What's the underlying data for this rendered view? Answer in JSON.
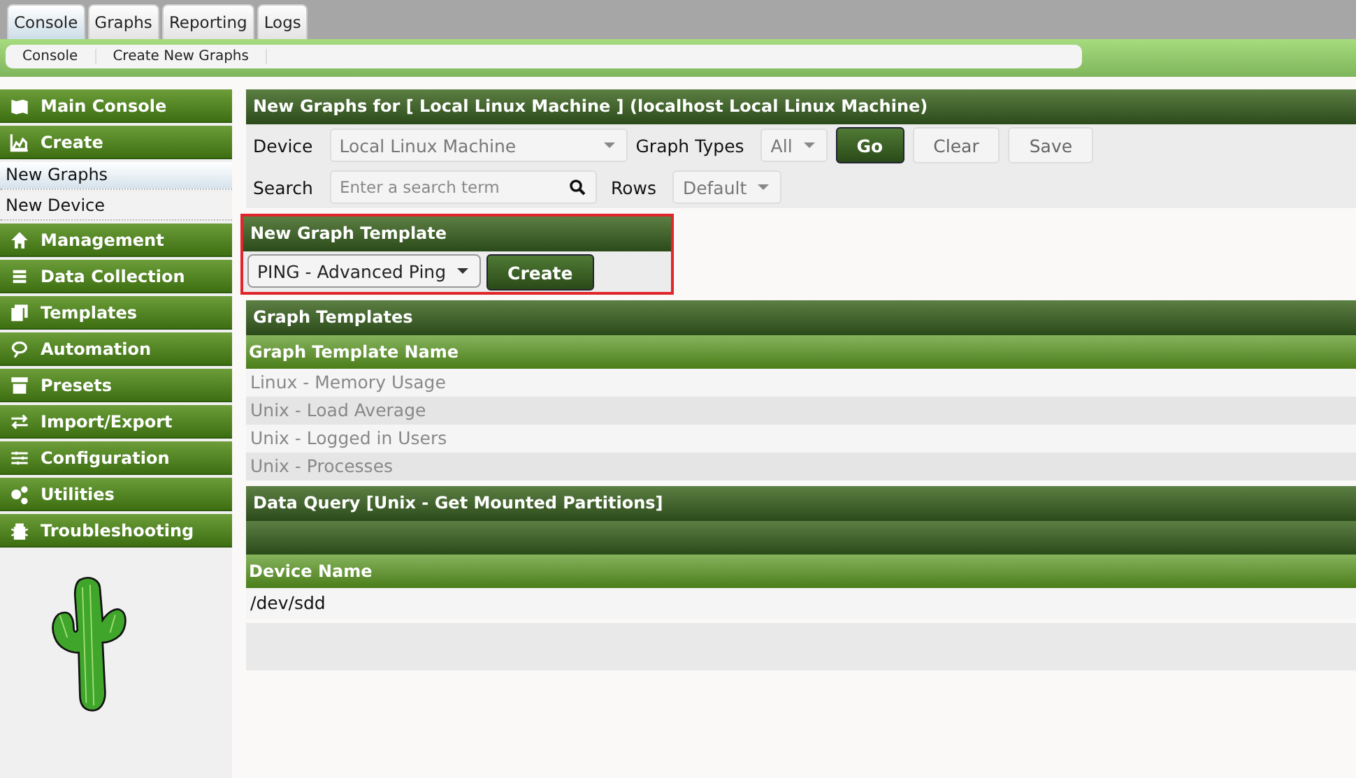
{
  "tabs": [
    {
      "label": "Console",
      "selected": true
    },
    {
      "label": "Graphs",
      "selected": false
    },
    {
      "label": "Reporting",
      "selected": false
    },
    {
      "label": "Logs",
      "selected": false
    }
  ],
  "breadcrumb": [
    "Console",
    "Create New Graphs"
  ],
  "sidebar": {
    "items": [
      {
        "kind": "header",
        "label": "Main Console",
        "selected": false
      },
      {
        "kind": "header",
        "label": "Create",
        "selected": false
      },
      {
        "kind": "sub",
        "label": "New Graphs",
        "selected": true
      },
      {
        "kind": "sub",
        "label": "New Device",
        "selected": false
      },
      {
        "kind": "header",
        "label": "Management",
        "selected": false
      },
      {
        "kind": "header",
        "label": "Data Collection",
        "selected": false
      },
      {
        "kind": "header",
        "label": "Templates",
        "selected": false
      },
      {
        "kind": "header",
        "label": "Automation",
        "selected": false
      },
      {
        "kind": "header",
        "label": "Presets",
        "selected": false
      },
      {
        "kind": "header",
        "label": "Import/Export",
        "selected": false
      },
      {
        "kind": "header",
        "label": "Configuration",
        "selected": false
      },
      {
        "kind": "header",
        "label": "Utilities",
        "selected": false
      },
      {
        "kind": "header",
        "label": "Troubleshooting",
        "selected": false
      }
    ]
  },
  "filter": {
    "title": "New Graphs for [ Local Linux Machine ] (localhost Local Linux Machine)",
    "device_label": "Device",
    "device_value": "Local Linux Machine",
    "graph_types_label": "Graph Types",
    "graph_types_value": "All",
    "go": "Go",
    "clear": "Clear",
    "save": "Save",
    "search_label": "Search",
    "search_placeholder": "Enter a search term",
    "rows_label": "Rows",
    "rows_value": "Default"
  },
  "template_section": {
    "title": "New Graph Template",
    "template_value": "PING - Advanced Ping",
    "create": "Create"
  },
  "graph_templates": {
    "title": "Graph Templates",
    "column": "Graph Template Name",
    "rows": [
      "Linux - Memory Usage",
      "Unix - Load Average",
      "Unix - Logged in Users",
      "Unix - Processes"
    ]
  },
  "data_query": {
    "title": "Data Query [Unix - Get Mounted Partitions]",
    "column": "Device Name",
    "rows": [
      "/dev/sdd"
    ]
  }
}
